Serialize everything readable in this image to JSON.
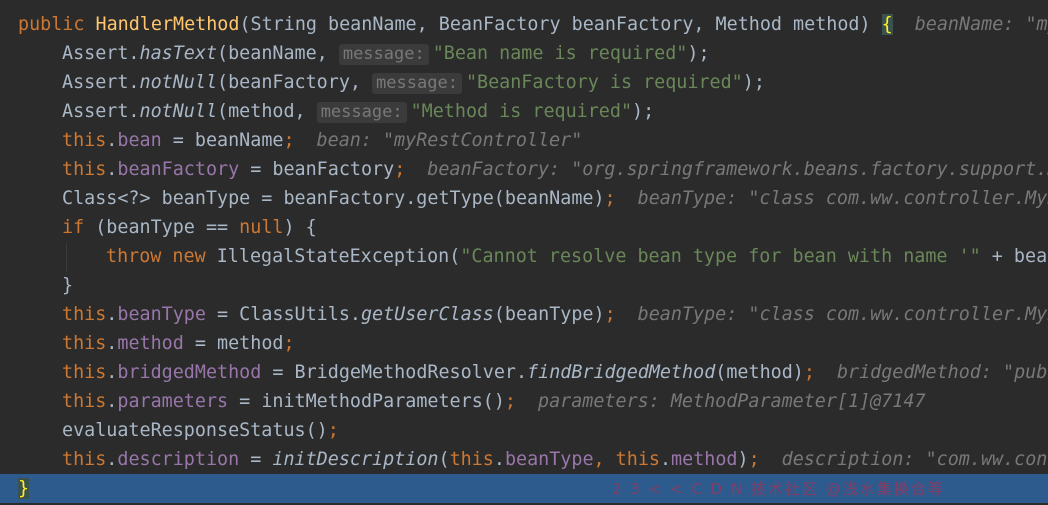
{
  "editor": {
    "theme_colors": {
      "background": "#2b2b2b",
      "keyword": "#cc7832",
      "field": "#9876aa",
      "string": "#6a8759",
      "method_declaration": "#ffc66d",
      "default_text": "#a9b7c6",
      "inline_value": "#787878",
      "current_line": "#2d5b8e"
    },
    "current_line_index": 16,
    "lines": [
      {
        "indent": 0,
        "tokens": [
          {
            "t": "public ",
            "c": "kw"
          },
          {
            "t": "HandlerMethod",
            "c": "fn"
          },
          {
            "t": "(String beanName, BeanFactory beanFactory, Method method) "
          },
          {
            "t": "{",
            "c": "brace"
          }
        ],
        "inline": "beanName: \"my"
      },
      {
        "indent": 1,
        "tokens": [
          {
            "t": "Assert."
          },
          {
            "t": "hasText",
            "c": "it"
          },
          {
            "t": "(beanName, "
          },
          {
            "t": "message:",
            "c": "hint"
          },
          {
            "t": "\"Bean name is required\"",
            "c": "str"
          },
          {
            "t": ");"
          }
        ]
      },
      {
        "indent": 1,
        "tokens": [
          {
            "t": "Assert."
          },
          {
            "t": "notNull",
            "c": "it"
          },
          {
            "t": "(beanFactory, "
          },
          {
            "t": "message:",
            "c": "hint"
          },
          {
            "t": "\"BeanFactory is required\"",
            "c": "str"
          },
          {
            "t": ");"
          }
        ]
      },
      {
        "indent": 1,
        "tokens": [
          {
            "t": "Assert."
          },
          {
            "t": "notNull",
            "c": "it"
          },
          {
            "t": "(method, "
          },
          {
            "t": "message:",
            "c": "hint"
          },
          {
            "t": "\"Method is required\"",
            "c": "str"
          },
          {
            "t": ");"
          }
        ]
      },
      {
        "indent": 1,
        "tokens": [
          {
            "t": "this",
            "c": "kw"
          },
          {
            "t": "."
          },
          {
            "t": "bean",
            "c": "fld"
          },
          {
            "t": " = beanName"
          },
          {
            "t": ";",
            "c": "kw"
          }
        ],
        "inline": "bean: \"myRestController\""
      },
      {
        "indent": 1,
        "tokens": [
          {
            "t": "this",
            "c": "kw"
          },
          {
            "t": "."
          },
          {
            "t": "beanFactory",
            "c": "fld"
          },
          {
            "t": " = beanFactory"
          },
          {
            "t": ";",
            "c": "kw"
          }
        ],
        "inline": "beanFactory: \"org.springframework.beans.factory.support.D"
      },
      {
        "indent": 1,
        "tokens": [
          {
            "t": "Class<?> beanType = beanFactory.getType(beanName)"
          },
          {
            "t": ";",
            "c": "kw"
          }
        ],
        "inline": "beanType: \"class com.ww.controller.MyR"
      },
      {
        "indent": 1,
        "tokens": [
          {
            "t": "if",
            "c": "kw"
          },
          {
            "t": " (beanType == "
          },
          {
            "t": "null",
            "c": "kw"
          },
          {
            "t": ") {"
          }
        ]
      },
      {
        "indent": 2,
        "tokens": [
          {
            "t": "throw new ",
            "c": "kw"
          },
          {
            "t": "IllegalStateException("
          },
          {
            "t": "\"Cannot resolve bean type for bean with name '\"",
            "c": "str"
          },
          {
            "t": " + bean"
          }
        ]
      },
      {
        "indent": 1,
        "tokens": [
          {
            "t": "}"
          }
        ]
      },
      {
        "indent": 1,
        "tokens": [
          {
            "t": "this",
            "c": "kw"
          },
          {
            "t": "."
          },
          {
            "t": "beanType",
            "c": "fld"
          },
          {
            "t": " = ClassUtils."
          },
          {
            "t": "getUserClass",
            "c": "it"
          },
          {
            "t": "(beanType)"
          },
          {
            "t": ";",
            "c": "kw"
          }
        ],
        "inline": "beanType: \"class com.ww.controller.MyR"
      },
      {
        "indent": 1,
        "tokens": [
          {
            "t": "this",
            "c": "kw"
          },
          {
            "t": "."
          },
          {
            "t": "method",
            "c": "fld"
          },
          {
            "t": " = method"
          },
          {
            "t": ";",
            "c": "kw"
          }
        ]
      },
      {
        "indent": 1,
        "tokens": [
          {
            "t": "this",
            "c": "kw"
          },
          {
            "t": "."
          },
          {
            "t": "bridgedMethod",
            "c": "fld"
          },
          {
            "t": " = BridgeMethodResolver."
          },
          {
            "t": "findBridgedMethod",
            "c": "it"
          },
          {
            "t": "(method)"
          },
          {
            "t": ";",
            "c": "kw"
          }
        ],
        "inline": "bridgedMethod: \"publ"
      },
      {
        "indent": 1,
        "tokens": [
          {
            "t": "this",
            "c": "kw"
          },
          {
            "t": "."
          },
          {
            "t": "parameters",
            "c": "fld"
          },
          {
            "t": " = initMethodParameters()"
          },
          {
            "t": ";",
            "c": "kw"
          }
        ],
        "inline": "parameters: MethodParameter[1]@7147"
      },
      {
        "indent": 1,
        "tokens": [
          {
            "t": "evaluateResponseStatus()"
          },
          {
            "t": ";",
            "c": "kw"
          }
        ]
      },
      {
        "indent": 1,
        "tokens": [
          {
            "t": "this",
            "c": "kw"
          },
          {
            "t": "."
          },
          {
            "t": "description",
            "c": "fld"
          },
          {
            "t": " = "
          },
          {
            "t": "initDescription",
            "c": "it"
          },
          {
            "t": "("
          },
          {
            "t": "this",
            "c": "kw"
          },
          {
            "t": "."
          },
          {
            "t": "beanType",
            "c": "fld"
          },
          {
            "t": ", ",
            "c": "kw"
          },
          {
            "t": "this",
            "c": "kw"
          },
          {
            "t": "."
          },
          {
            "t": "method",
            "c": "fld"
          },
          {
            "t": ")"
          },
          {
            "t": ";",
            "c": "kw"
          }
        ],
        "inline": "description: \"com.ww.cont"
      },
      {
        "indent": 0,
        "tokens": [
          {
            "t": "}",
            "c": "brace"
          }
        ]
      }
    ]
  },
  "watermark": {
    "text": "2 3 < < C D N  技术社区  @浅水集换合等"
  }
}
